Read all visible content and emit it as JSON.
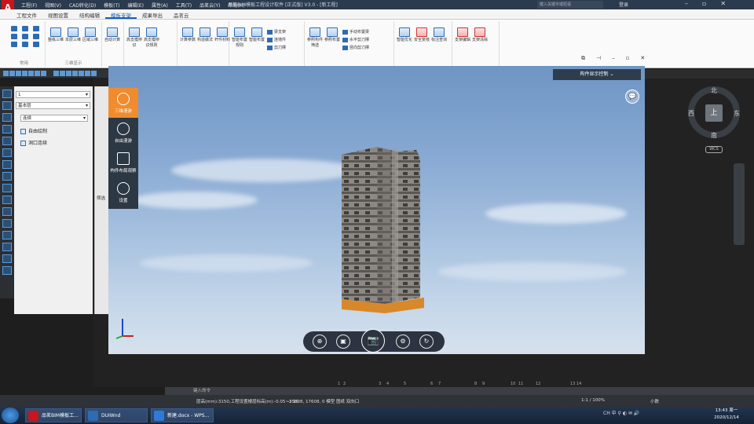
{
  "titlebar": {
    "app_logo": "A",
    "menus": [
      "工程(F)",
      "视图(V)",
      "CAD转化(D)",
      "模板(T)",
      "编辑(E)",
      "属性(A)",
      "工具(T)",
      "品茗云(Y)",
      "帮助(H)"
    ],
    "title": "品茗BIM模板工程设计软件 [正式版] V3.0 - [新工程]",
    "search_placeholder": "键入关键字或短语",
    "login": "登录"
  },
  "ribbon": {
    "tabs": [
      "工程文件",
      "视图设置",
      "结构编辑",
      "模板支架",
      "成果导出",
      "品茗云"
    ],
    "active_tab": "模板支架",
    "groups": [
      {
        "label": "常用"
      },
      {
        "label": "三维显示",
        "buttons": [
          "整栋三维",
          "本层三维",
          "区域三维"
        ]
      },
      {
        "label": "",
        "buttons": [
          "自动计算"
        ]
      },
      {
        "label": "",
        "buttons": [
          "高支模辨识",
          "高支模辨识规则"
        ]
      },
      {
        "label": "",
        "buttons": [
          "计算参数",
          "构造做法",
          "杆件材料"
        ]
      },
      {
        "label": "",
        "buttons": [
          "智能布置规则",
          "智能布置"
        ],
        "small": [
          "梁支架",
          "连墙件",
          "剪刀撑"
        ]
      },
      {
        "label": "",
        "buttons": [
          "参照构件筛选",
          "参照布置"
        ],
        "small": [
          "手动布置梁",
          "水平剪刀撑",
          "竖向剪刀撑"
        ]
      },
      {
        "label": "",
        "buttons": [
          "智能优化",
          "安全复核",
          "标注查询"
        ]
      },
      {
        "label": "",
        "buttons": [
          "支架编辑",
          "支架清除"
        ]
      }
    ]
  },
  "left_panel": {
    "floor_combo": "1",
    "layer_combo": "基本层",
    "mode_combo": "连续",
    "items": [
      "自由绘制",
      "洞口连续"
    ],
    "side_tab": "筛选"
  },
  "viewer": {
    "component_display": "构件显示控制",
    "bubble_icon": "💬",
    "side_items": [
      {
        "label": "三维漫游",
        "active": true
      },
      {
        "label": "自由漫游",
        "active": false
      },
      {
        "label": "构件布局观察",
        "active": false
      },
      {
        "label": "设置",
        "active": false
      }
    ],
    "bottom_tools": [
      "⊕",
      "▣",
      "📷",
      "⚙",
      "↻"
    ]
  },
  "compass": {
    "north": "北",
    "south": "南",
    "east": "东",
    "west": "西",
    "center": "上",
    "wcs": "WCS"
  },
  "axis_tags": [
    "1",
    "2",
    "3",
    "4",
    "5",
    "6",
    "7",
    "8",
    "9",
    "10",
    "11",
    "12",
    "13",
    "14"
  ],
  "command_line": {
    "placeholder": "键入命令"
  },
  "statusbar": {
    "text": "层高(mm):3150,工程设置楼层标高(m):-0.05~3.10",
    "coords": "-25808, 17608, 0  模型  图纸  双向口",
    "zoom": "1:1 / 100%",
    "decimal": "小数"
  },
  "taskbar": {
    "apps": [
      {
        "label": "品茗BIM模板工...",
        "color": "#c8161d"
      },
      {
        "label": "DUIWnd",
        "color": "#2d6bb3"
      },
      {
        "label": "新建.docx - WPS...",
        "color": "#2d7bd6"
      }
    ],
    "tray": "CH  中  ⚲  ◐  ✉  🔊",
    "time": "13:43 周一",
    "date": "2020/12/14"
  }
}
